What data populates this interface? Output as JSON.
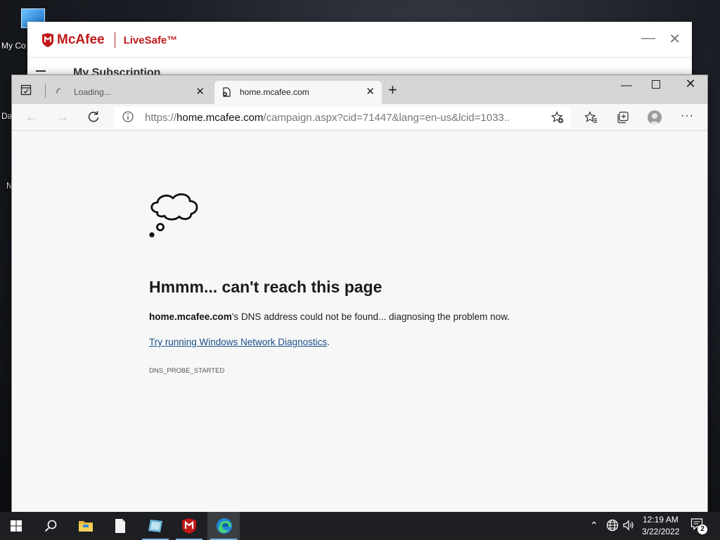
{
  "desktop": {
    "icon_label": "My Co",
    "fragment_1": "Da",
    "fragment_2": "N"
  },
  "mcafee": {
    "brand": "McAfee",
    "product": "LiveSafe™",
    "subscription_heading": "My Subscription",
    "brand_color": "#c01818"
  },
  "browser": {
    "tabs": [
      {
        "label": "Loading...",
        "icon": "loading-spinner-icon"
      },
      {
        "label": "home.mcafee.com",
        "icon": "error-page-icon"
      }
    ],
    "address": {
      "scheme": "https://",
      "host": "home.mcafee.com",
      "rest": "/campaign.aspx?cid=71447&lang=en-us&lcid=1033..."
    }
  },
  "error_page": {
    "title": "Hmmm... can't reach this page",
    "host": "home.mcafee.com",
    "message": "'s DNS address could not be found... diagnosing the problem now.",
    "link_text": "Try running Windows Network Diagnostics",
    "link_suffix": ".",
    "error_code": "DNS_PROBE_STARTED",
    "link_color": "#1a4f8a"
  },
  "taskbar": {
    "time": "12:19 AM",
    "date": "3/22/2022",
    "notification_count": "2",
    "accent": "#7eb4ea"
  }
}
